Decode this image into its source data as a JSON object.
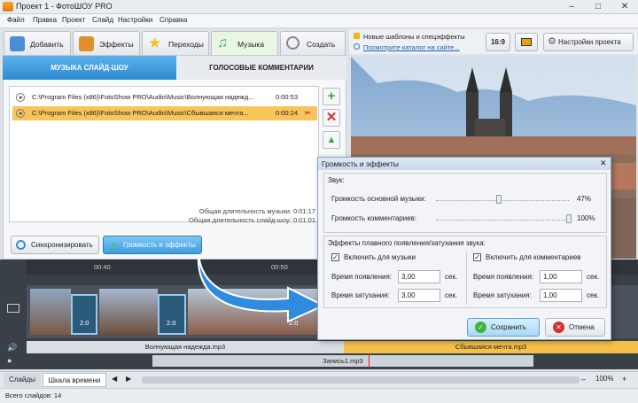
{
  "window": {
    "title": "Проект 1 - ФотоШОУ PRO",
    "minimize": "–",
    "maximize": "□",
    "close": "✕"
  },
  "menu": [
    "Файл",
    "Правка",
    "Проект",
    "Слайд",
    "Настройки",
    "Справка"
  ],
  "main_tabs": [
    {
      "label": "Добавить",
      "icon": "add-photos-icon",
      "color": "#4a8fd6"
    },
    {
      "label": "Эффекты",
      "icon": "effects-icon",
      "color": "#e0902a"
    },
    {
      "label": "Переходы",
      "icon": "star-icon",
      "color": "#f1c21f"
    },
    {
      "label": "Музыка",
      "icon": "music-note-icon",
      "color": "#3fb24a"
    },
    {
      "label": "Создать",
      "icon": "disc-icon",
      "color": "#888"
    }
  ],
  "sub_tabs": {
    "music": "МУЗЫКА СЛАЙД-ШОУ",
    "voice": "ГОЛОСОВЫЕ КОММЕНТАРИИ"
  },
  "tracks": [
    {
      "path": "C:\\Program Files (x86)\\FotoShow PRO\\Audio\\Music\\Волнующая надежд...",
      "duration": "0:00:53",
      "selected": false
    },
    {
      "path": "C:\\Program Files (x86)\\FotoShow PRO\\Audio\\Music\\Сбывшаяся мечта...",
      "duration": "0:00:24",
      "selected": true
    }
  ],
  "summary": {
    "music_label": "Общая длительность музыки:",
    "music_value": "0:01:17",
    "show_label": "Общая длительность слайд-шоу:",
    "show_value": "0:01:01"
  },
  "buttons": {
    "sync": "Синхронизировать",
    "volume": "Громкость и эффекты"
  },
  "right_header": {
    "news": "Новые шаблоны и спецэффекты",
    "catalog": "Посмотрите каталог на сайте...",
    "ratio": "16:9",
    "settings": "Настройки проекта"
  },
  "timeline": {
    "ticks": [
      "00:40",
      "00:50"
    ],
    "durations": [
      "2.0",
      "2.0",
      "2.0"
    ],
    "music1": "Волнующая надежда.mp3",
    "music2": "Сбывшаяся мечта.mp3",
    "voice": "Запись1.mp3"
  },
  "bottom_tabs": {
    "slides": "Слайды",
    "timeline": "Шкала времени",
    "zoom": "100%",
    "minus": "–",
    "plus": "+"
  },
  "status": "Всего слайдов: 14",
  "dialog": {
    "title": "Громкость и эффекты",
    "sound_group": "Звук:",
    "main_volume_label": "Громкость основной музыки:",
    "main_volume": "47%",
    "main_volume_value": 0.47,
    "comment_volume_label": "Громкость комментариев:",
    "comment_volume": "100%",
    "comment_volume_value": 1.0,
    "fade_group": "Эффекты плавного появления/затухания звука:",
    "music_check": "Включить для музыки",
    "comment_check": "Включить для комментариев",
    "fade_in_label": "Время появления:",
    "fade_out_label": "Время затухания:",
    "music_fade_in": "3,00",
    "music_fade_out": "3,00",
    "comment_fade_in": "1,00",
    "comment_fade_out": "1,00",
    "unit": "сек.",
    "save": "Сохранить",
    "cancel": "Отмена"
  }
}
